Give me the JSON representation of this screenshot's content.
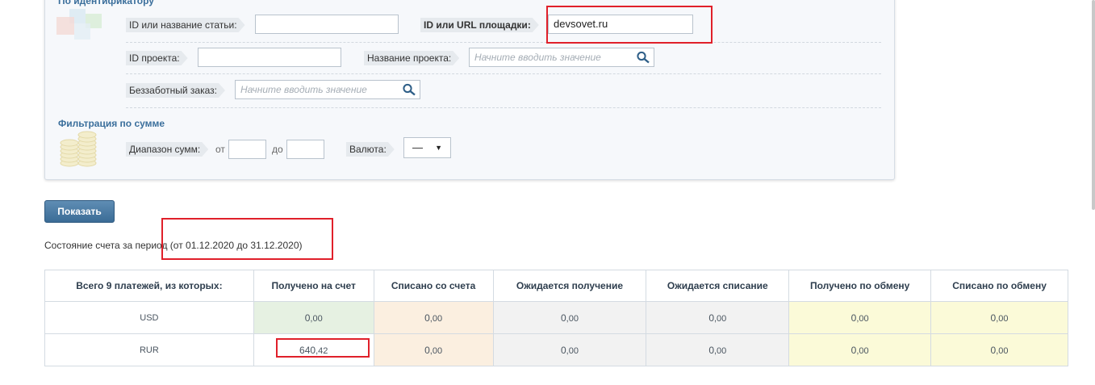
{
  "filter": {
    "id_section_title": "По идентификатору",
    "article_label": "ID или название статьи:",
    "article_value": "",
    "site_label": "ID или URL площадки:",
    "site_value": "devsovet.ru",
    "project_id_label": "ID проекта:",
    "project_id_value": "",
    "project_name_label": "Название проекта:",
    "project_name_placeholder": "Начните вводить значение",
    "carefree_label": "Беззаботный заказ:",
    "carefree_placeholder": "Начните вводить значение",
    "sum_section_title": "Фильтрация по сумме",
    "range_label": "Диапазон сумм:",
    "from_label": "от",
    "to_label": "до",
    "currency_label": "Валюта:",
    "currency_value": "—"
  },
  "show_button": "Показать",
  "period": {
    "prefix": "Состояние счета за период",
    "range": "(от 01.12.2020 до 31.12.2020)"
  },
  "summary": {
    "headers": [
      "Всего 9 платежей, из которых:",
      "Получено на счет",
      "Списано со счета",
      "Ожидается получение",
      "Ожидается списание",
      "Получено по обмену",
      "Списано по обмену"
    ],
    "rows": [
      {
        "currency": "USD",
        "recv_int": "0",
        "recv_dec": ",00",
        "writ_int": "0",
        "writ_dec": ",00",
        "wait_in_int": "0",
        "wait_in_dec": ",00",
        "wait_out_int": "0",
        "wait_out_dec": ",00",
        "xin_int": "0",
        "xin_dec": ",00",
        "xout_int": "0",
        "xout_dec": ",00"
      },
      {
        "currency": "RUR",
        "recv_int": "640",
        "recv_dec": ",42",
        "writ_int": "0",
        "writ_dec": ",00",
        "wait_in_int": "0",
        "wait_in_dec": ",00",
        "wait_out_int": "0",
        "wait_out_dec": ",00",
        "xin_int": "0",
        "xin_dec": ",00",
        "xout_int": "0",
        "xout_dec": ",00"
      }
    ]
  },
  "colors": {
    "accent": "#3b6f9c",
    "highlight": "#e0202a"
  }
}
